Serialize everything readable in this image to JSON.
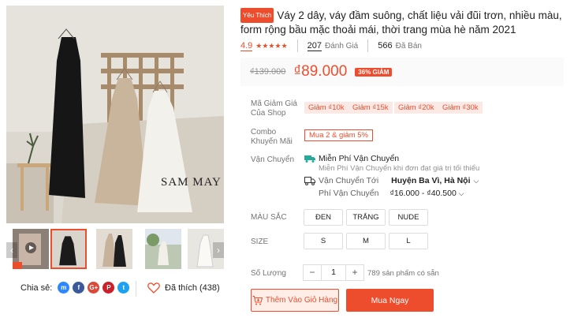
{
  "gallery": {
    "watermark": "SAM MAY",
    "thumbnails": [
      {
        "name": "thumb-video",
        "active": false
      },
      {
        "name": "thumb-black-dress",
        "active": true
      },
      {
        "name": "thumb-beige-dress",
        "active": false
      },
      {
        "name": "thumb-outdoor",
        "active": false
      },
      {
        "name": "thumb-white-dress",
        "active": false
      }
    ],
    "video_badge": "$$"
  },
  "share": {
    "label": "Chia sẻ:",
    "networks": [
      {
        "name": "messenger-icon",
        "glyph": "m",
        "color": "#2d88ff"
      },
      {
        "name": "facebook-icon",
        "glyph": "f",
        "color": "#3b5998"
      },
      {
        "name": "google-plus-icon",
        "glyph": "G+",
        "color": "#db4a39"
      },
      {
        "name": "pinterest-icon",
        "glyph": "P",
        "color": "#cb2027"
      },
      {
        "name": "twitter-icon",
        "glyph": "t",
        "color": "#1da1f2"
      }
    ]
  },
  "like": {
    "label": "Đã thích (438)"
  },
  "product": {
    "badge": "Yêu Thích",
    "title": "Váy 2 dây, váy đầm suông, chất liệu vải đũi trơn, nhiều màu, form rộng bầu mặc thoải mái, thời trang mùa hè năm 2021"
  },
  "stats": {
    "rating": "4.9",
    "stars": "★★★★★",
    "reviews_count": "207",
    "reviews_label": "Đánh Giá",
    "sold_count": "566",
    "sold_label": "Đã Bán"
  },
  "price": {
    "old": "₫139.000",
    "new": "₫89.000",
    "discount": "36% GIẢM"
  },
  "vouchers": {
    "label": "Mã Giảm Giá Của Shop",
    "items": [
      "Giảm ₫10k",
      "Giảm ₫15k",
      "Giảm ₫20k",
      "Giảm ₫30k"
    ]
  },
  "combo": {
    "label": "Combo Khuyến Mãi",
    "value": "Mua 2 & giảm 5%"
  },
  "shipping": {
    "label": "Vận Chuyển",
    "free_title": "Miễn Phí Vận Chuyển",
    "free_sub": "Miễn Phí Vận Chuyển khi đơn đạt giá trị tối thiểu",
    "to_label": "Vận Chuyển Tới",
    "to_value": "Huyện Ba Vì, Hà Nội",
    "fee_label": "Phí Vận Chuyển",
    "fee_value": "₫16.000 - ₫40.500"
  },
  "colors": {
    "label": "MÀU SẮC",
    "options": [
      "ĐEN",
      "TRẮNG",
      "NUDE"
    ]
  },
  "sizes": {
    "label": "SIZE",
    "options": [
      "S",
      "M",
      "L"
    ]
  },
  "quantity": {
    "label": "Số Lượng",
    "minus": "−",
    "value": "1",
    "plus": "+",
    "stock": "789 sản phẩm có sẵn"
  },
  "actions": {
    "add_to_cart": "Thêm Vào Giỏ Hàng",
    "buy_now": "Mua Ngay"
  },
  "theme": {
    "accent": "#ee4d2d"
  }
}
